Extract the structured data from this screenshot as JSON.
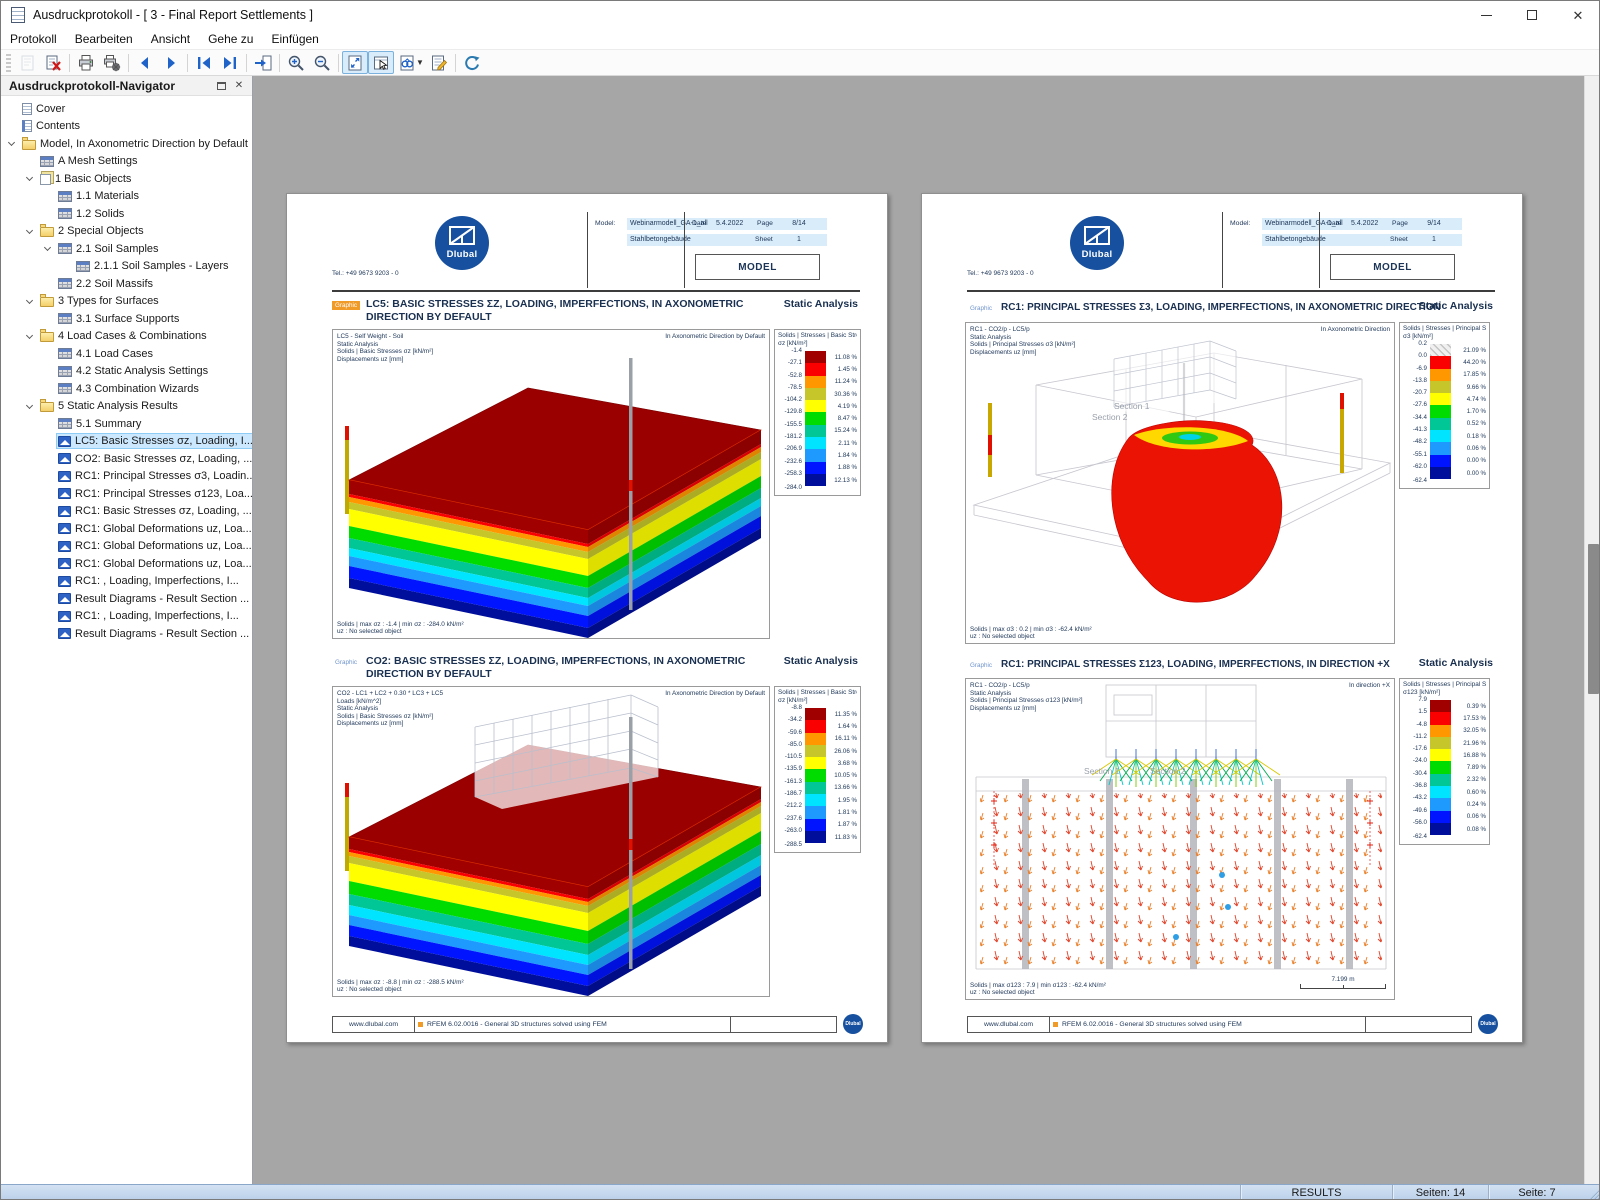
{
  "window": {
    "title": "Ausdruckprotokoll - [ 3 - Final Report Settlements ]"
  },
  "menu": {
    "items": [
      "Protokoll",
      "Bearbeiten",
      "Ansicht",
      "Gehe zu",
      "Einfügen"
    ]
  },
  "navigator": {
    "title": "Ausdruckprotokoll-Navigator",
    "items": [
      {
        "label": "Cover",
        "level": 1,
        "icon": "doc",
        "chev": false
      },
      {
        "label": "Contents",
        "level": 1,
        "icon": "doc2",
        "chev": false
      },
      {
        "label": "Model, In Axonometric Direction by Default",
        "level": 1,
        "icon": "folder",
        "chev": true
      },
      {
        "label": "A Mesh Settings",
        "level": 2,
        "icon": "table",
        "chev": false
      },
      {
        "label": "1 Basic Objects",
        "level": 2,
        "icon": "pages",
        "chev": true
      },
      {
        "label": "1.1 Materials",
        "level": 3,
        "icon": "table",
        "chev": false
      },
      {
        "label": "1.2 Solids",
        "level": 3,
        "icon": "table",
        "chev": false
      },
      {
        "label": "2 Special Objects",
        "level": 2,
        "icon": "folder",
        "chev": true
      },
      {
        "label": "2.1 Soil Samples",
        "level": 3,
        "icon": "table",
        "chev": true
      },
      {
        "label": "2.1.1 Soil Samples - Layers",
        "level": 4,
        "icon": "table",
        "chev": false
      },
      {
        "label": "2.2 Soil Massifs",
        "level": 3,
        "icon": "table",
        "chev": false
      },
      {
        "label": "3 Types for Surfaces",
        "level": 2,
        "icon": "folder",
        "chev": true
      },
      {
        "label": "3.1 Surface Supports",
        "level": 3,
        "icon": "table",
        "chev": false
      },
      {
        "label": "4 Load Cases & Combinations",
        "level": 2,
        "icon": "folder",
        "chev": true
      },
      {
        "label": "4.1 Load Cases",
        "level": 3,
        "icon": "table",
        "chev": false
      },
      {
        "label": "4.2 Static Analysis Settings",
        "level": 3,
        "icon": "table",
        "chev": false
      },
      {
        "label": "4.3 Combination Wizards",
        "level": 3,
        "icon": "table",
        "chev": false
      },
      {
        "label": "5 Static Analysis Results",
        "level": 2,
        "icon": "folder",
        "chev": true
      },
      {
        "label": "5.1 Summary",
        "level": 3,
        "icon": "table",
        "chev": false
      },
      {
        "label": "LC5: Basic Stresses σz, Loading, I...",
        "level": 3,
        "icon": "img",
        "chev": false,
        "sel": true
      },
      {
        "label": "CO2: Basic Stresses σz, Loading, ...",
        "level": 3,
        "icon": "img",
        "chev": false
      },
      {
        "label": "RC1: Principal Stresses σ3, Loadin...",
        "level": 3,
        "icon": "img",
        "chev": false
      },
      {
        "label": "RC1: Principal Stresses σ123, Loa...",
        "level": 3,
        "icon": "img",
        "chev": false
      },
      {
        "label": "RC1: Basic Stresses σz, Loading, ...",
        "level": 3,
        "icon": "img",
        "chev": false
      },
      {
        "label": "RC1: Global Deformations uz, Loa...",
        "level": 3,
        "icon": "img",
        "chev": false
      },
      {
        "label": "RC1: Global Deformations uz, Loa...",
        "level": 3,
        "icon": "img",
        "chev": false
      },
      {
        "label": "RC1: Global Deformations uz, Loa...",
        "level": 3,
        "icon": "img",
        "chev": false
      },
      {
        "label": "RC1: , Loading, Imperfections, I...",
        "level": 3,
        "icon": "img",
        "chev": false
      },
      {
        "label": "Result Diagrams - Result Section ...",
        "level": 3,
        "icon": "img",
        "chev": false
      },
      {
        "label": "RC1: , Loading, Imperfections, I...",
        "level": 3,
        "icon": "img",
        "chev": false
      },
      {
        "label": "Result Diagrams - Result Section ...",
        "level": 3,
        "icon": "img",
        "chev": false
      }
    ]
  },
  "statusbar": {
    "results": "RESULTS",
    "pages_total": "Seiten: 14",
    "current_page": "Seite: 7"
  },
  "footer": {
    "url": "www.dlubal.com",
    "app_line": "RFEM 6.02.0016 - General 3D structures solved using FEM"
  },
  "header_labels": {
    "model": "Model:",
    "date": "Date",
    "page": "Page",
    "sheet": "Sheet",
    "doc_type": "MODEL",
    "tel": "Tel.: +49 9673 9203 - 0",
    "logo_text": "Dlubal"
  },
  "pages": [
    {
      "model_name": "Webinarmodell_GA-1_all",
      "model_desc": "Stahlbetongebäude",
      "date": "5.4.2022",
      "page_no": "8/14",
      "sheet_no": "1",
      "graphics": [
        {
          "badge": "Graphic",
          "title": "LC5: BASIC STRESSES σz, LOADING, IMPERFECTIONS, IN AXONOMETRIC DIRECTION BY DEFAULT",
          "analysis": "Static Analysis",
          "info": "LC5 - Self Weight - Soil\nStatic Analysis\nSolids | Basic Stresses σz [kN/m²]\nDisplacements uz [mm]",
          "view": "In Axonometric Direction by Default",
          "result": "Solids | max σz : -1.4 | min σz : -284.0 kN/m²",
          "result2": "uz : No selected object",
          "legend": {
            "title": "Solids | Stresses | Basic Stresses",
            "unit": "σz [kN/m²]",
            "values": [
              "-1.4",
              "-27.1",
              "-52.8",
              "-78.5",
              "-104.2",
              "-129.8",
              "-155.5",
              "-181.2",
              "-206.9",
              "-232.6",
              "-258.3",
              "-284.0"
            ],
            "percents": [
              "11.08 %",
              "1.45 %",
              "11.24 %",
              "30.36 %",
              "4.19 %",
              "8.47 %",
              "15.24 %",
              "2.11 %",
              "1.84 %",
              "1.88 %",
              "12.13 %"
            ],
            "colors": [
              "#a00000",
              "#fb0000",
              "#ff9800",
              "#c6c62a",
              "#ffff00",
              "#00dc00",
              "#00c795",
              "#00e4ff",
              "#1e9aff",
              "#0014ff",
              "#000f9b"
            ]
          }
        },
        {
          "badge": "Graphic",
          "title": "CO2: BASIC STRESSES σz, LOADING, IMPERFECTIONS, IN AXONOMETRIC DIRECTION BY DEFAULT",
          "analysis": "Static Analysis",
          "info": "CO2 - LC1 + LC2 + 0.30 * LC3 + LC5\nLoads [kN/m^2]\nStatic Analysis\nSolids | Basic Stresses σz [kN/m²]\nDisplacements uz [mm]",
          "view": "In Axonometric Direction by Default",
          "result": "Solids | max σz : -8.8 | min σz : -288.5 kN/m²",
          "result2": "uz : No selected object",
          "legend": {
            "title": "Solids | Stresses | Basic Stresses",
            "unit": "σz [kN/m²]",
            "values": [
              "-8.8",
              "-34.2",
              "-59.6",
              "-85.0",
              "-110.5",
              "-135.9",
              "-161.3",
              "-186.7",
              "-212.2",
              "-237.6",
              "-263.0",
              "-288.5"
            ],
            "percents": [
              "11.35 %",
              "1.64 %",
              "16.11 %",
              "26.06 %",
              "3.68 %",
              "10.05 %",
              "13.66 %",
              "1.95 %",
              "1.81 %",
              "1.87 %",
              "11.83 %"
            ],
            "colors": [
              "#a00000",
              "#fb0000",
              "#ff9800",
              "#c6c62a",
              "#ffff00",
              "#00dc00",
              "#00c795",
              "#00e4ff",
              "#1e9aff",
              "#0014ff",
              "#000f9b"
            ]
          }
        }
      ]
    },
    {
      "model_name": "Webinarmodell_GA-1_all",
      "model_desc": "Stahlbetongebäude",
      "date": "5.4.2022",
      "page_no": "9/14",
      "sheet_no": "1",
      "graphics": [
        {
          "badge": "Graphic",
          "title": "RC1: PRINCIPAL STRESSES σ3, LOADING, IMPERFECTIONS, IN AXONOMETRIC DIRECTION",
          "analysis": "Static Analysis",
          "info": "RC1 - CO2/p - LC5/p\nStatic Analysis\nSolids | Principal Stresses σ3 [kN/m²]\nDisplacements uz [mm]",
          "view": "In Axonometric Direction",
          "result": "Solids | max σ3 : 0.2 | min σ3 : -62.4 kN/m²",
          "result2": "uz : No selected object",
          "section1": "Section 1",
          "section2": "Section 2",
          "legend": {
            "title": "Solids | Stresses | Principal Stresses",
            "unit": "σ3 [kN/m²]",
            "values": [
              "0.2",
              "0.0",
              "-6.9",
              "-13.8",
              "-20.7",
              "-27.6",
              "-34.4",
              "-41.3",
              "-48.2",
              "-55.1",
              "-62.0",
              "-62.4"
            ],
            "percents": [
              "21.09 %",
              "44.20 %",
              "17.85 %",
              "9.66 %",
              "4.74 %",
              "1.70 %",
              "0.52 %",
              "0.18 %",
              "0.06 %",
              "0.00 %",
              "0.00 %"
            ],
            "colors": [
              "hatch",
              "#fb0000",
              "#ff9800",
              "#c6c62a",
              "#ffff00",
              "#00dc00",
              "#00c795",
              "#00e4ff",
              "#1e9aff",
              "#0014ff",
              "#000f9b"
            ]
          }
        },
        {
          "badge": "Graphic",
          "title": "RC1: PRINCIPAL STRESSES σ123, LOADING, IMPERFECTIONS, IN DIRECTION +X",
          "analysis": "Static Analysis",
          "info": "RC1 - CO2/p - LC5/p\nStatic Analysis\nSolids | Principal Stresses σ123 [kN/m²]\nDisplacements uz [mm]",
          "view": "In direction +X",
          "result": "Solids | max σ123 : 7.9 | min σ123 : -62.4 kN/m²",
          "result2": "uz : No selected object",
          "scale": "7.199 m",
          "section1": "Section 1",
          "section2": "Section 2",
          "legend": {
            "title": "Solids | Stresses | Principal Stresses",
            "unit": "σ123 [kN/m²]",
            "values": [
              "7.9",
              "1.5",
              "-4.8",
              "-11.2",
              "-17.6",
              "-24.0",
              "-30.4",
              "-36.8",
              "-43.2",
              "-49.6",
              "-56.0",
              "-62.4"
            ],
            "percents": [
              "0.39 %",
              "17.53 %",
              "32.05 %",
              "21.96 %",
              "16.88 %",
              "7.89 %",
              "2.32 %",
              "0.60 %",
              "0.24 %",
              "0.06 %",
              "0.08 %"
            ],
            "colors": [
              "#a00000",
              "#fb0000",
              "#ff9800",
              "#c6c62a",
              "#ffff00",
              "#00dc00",
              "#00c795",
              "#00e4ff",
              "#1e9aff",
              "#0014ff",
              "#000f9b"
            ]
          }
        }
      ]
    }
  ]
}
